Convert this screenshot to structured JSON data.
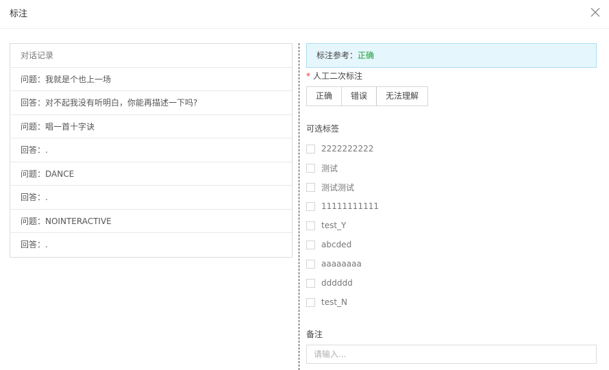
{
  "modal": {
    "title": "标注",
    "close_icon": "close-icon"
  },
  "chat": {
    "header": "对话记录",
    "rows": [
      "问题：我就是个也上一场",
      "回答：对不起我没有听明白，你能再描述一下吗?",
      "问题：唱一首十字诀",
      "回答：.",
      "问题：DANCE",
      "回答：.",
      "问题：NOINTERACTIVE",
      "回答：."
    ]
  },
  "reference": {
    "label": "标注参考：",
    "value": "正确",
    "value_color": "#1aa034"
  },
  "manual": {
    "star": "*",
    "label": "人工二次标注",
    "buttons": [
      "正确",
      "错误",
      "无法理解"
    ]
  },
  "tags": {
    "title": "可选标签",
    "items": [
      "2222222222",
      "测试",
      "测试测试",
      "11111111111",
      "test_Y",
      "abcded",
      "aaaaaaaa",
      "dddddd",
      "test_N"
    ]
  },
  "remark": {
    "title": "备注",
    "placeholder": "请输入..."
  }
}
